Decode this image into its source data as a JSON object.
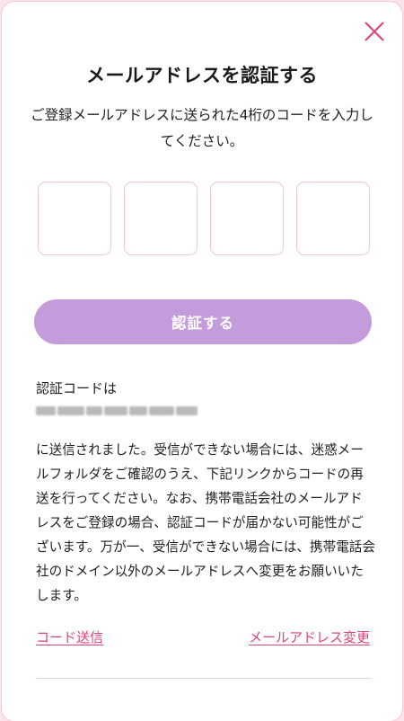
{
  "dialog": {
    "title": "メールアドレスを認証する",
    "instruction": "ご登録メールアドレスに送られた4桁のコードを入力してください。",
    "code_boxes": [
      "",
      "",
      "",
      ""
    ],
    "verify_label": "認証する",
    "code_label": "認証コードは",
    "body_text": "に送信されました。受信ができない場合には、迷惑メールフォルダをご確認のうえ、下記リンクからコードの再送を行ってください。なお、携帯電話会社のメールアドレスをご登録の場合、認証コードが届かない可能性がございます。万が一、受信ができない場合には、携帯電話会社のドメイン以外のメールアドレスへ変更をお願いいたします。",
    "link_resend": "コード送信",
    "link_change_email": "メールアドレス変更",
    "icons": {
      "close": "close-icon"
    },
    "colors": {
      "accent": "#e0427a",
      "button": "#c49bdb",
      "box_border": "#f2c6d2"
    }
  }
}
